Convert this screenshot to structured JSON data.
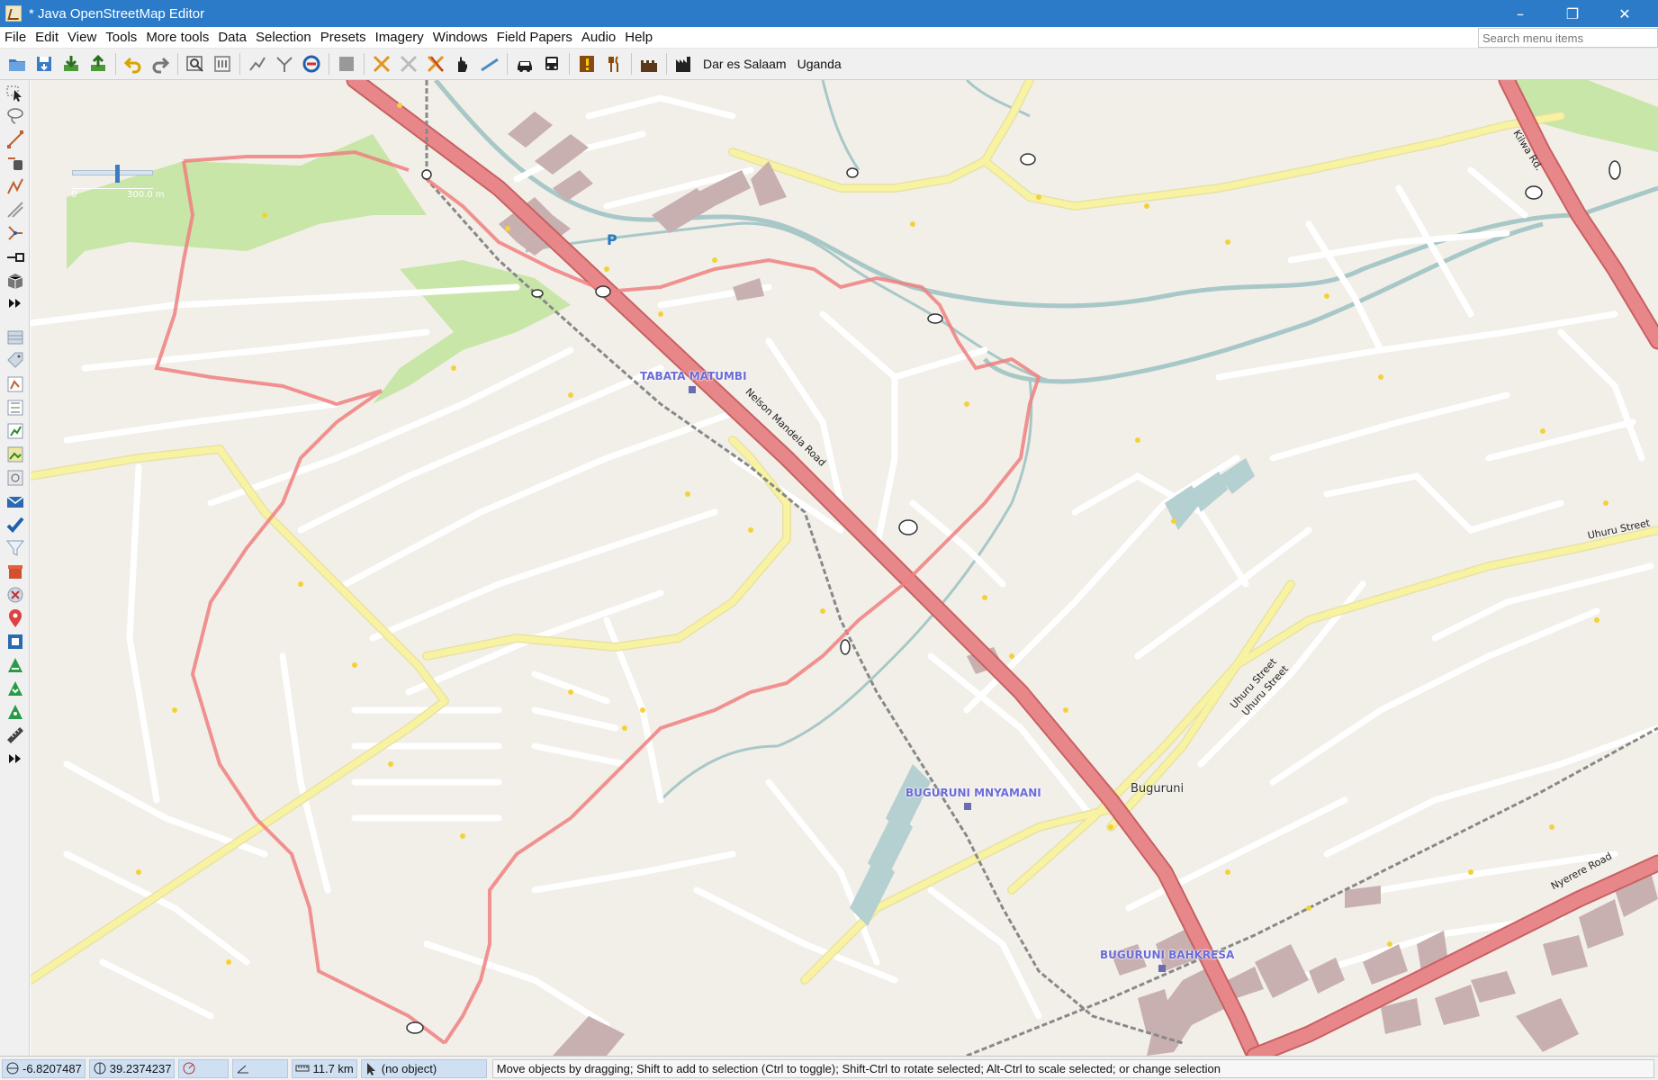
{
  "window": {
    "title": "* Java OpenStreetMap Editor",
    "controls": {
      "minimize": "–",
      "restore": "❐",
      "close": "✕"
    }
  },
  "menubar": {
    "items": [
      "File",
      "Edit",
      "View",
      "Tools",
      "More tools",
      "Data",
      "Selection",
      "Presets",
      "Imagery",
      "Windows",
      "Field Papers",
      "Audio",
      "Help"
    ],
    "search_placeholder": "Search menu items"
  },
  "toolbar": {
    "presets": [
      "Dar es Salaam",
      "Uganda"
    ]
  },
  "map": {
    "scale": {
      "start": "0",
      "end": "300.0 m"
    },
    "stations": [
      {
        "label": "TABATA MATUMBI"
      },
      {
        "label": "BUGURUNI MNYAMANI"
      },
      {
        "label": "BUGURUNI BAHKRESA"
      }
    ],
    "places": {
      "buguruni": "Buguruni"
    },
    "roads": {
      "nelson_mandela": "Nelson Mandela Road",
      "kilwa": "Kilwa Rd.",
      "uhuru_1": "Uhuru Street",
      "uhuru_2": "Uhuru Street",
      "uhuru_3": "Uhuru Street",
      "nyerere": "Nyerere Road"
    },
    "parking_symbol": "P"
  },
  "statusbar": {
    "lat": "-6.8207487",
    "lon": "39.2374237",
    "heading": "",
    "angle": "",
    "distance": "11.7 km",
    "object": "(no object)",
    "message": "Move objects by dragging; Shift to add to selection (Ctrl to toggle); Shift-Ctrl to rotate selected; Alt-Ctrl to scale selected; or change selection"
  },
  "colors": {
    "titlebar": "#2b7bc8",
    "map_bg": "#f2efe9",
    "primary_road": "#e8878a",
    "secondary_road": "#f7f3a3",
    "minor_road": "#ffffff",
    "river": "#a8c8c8",
    "park": "#c8e6a8",
    "building": "#c8b0b0",
    "water": "#aad3df",
    "gps_track": "#f08080"
  }
}
